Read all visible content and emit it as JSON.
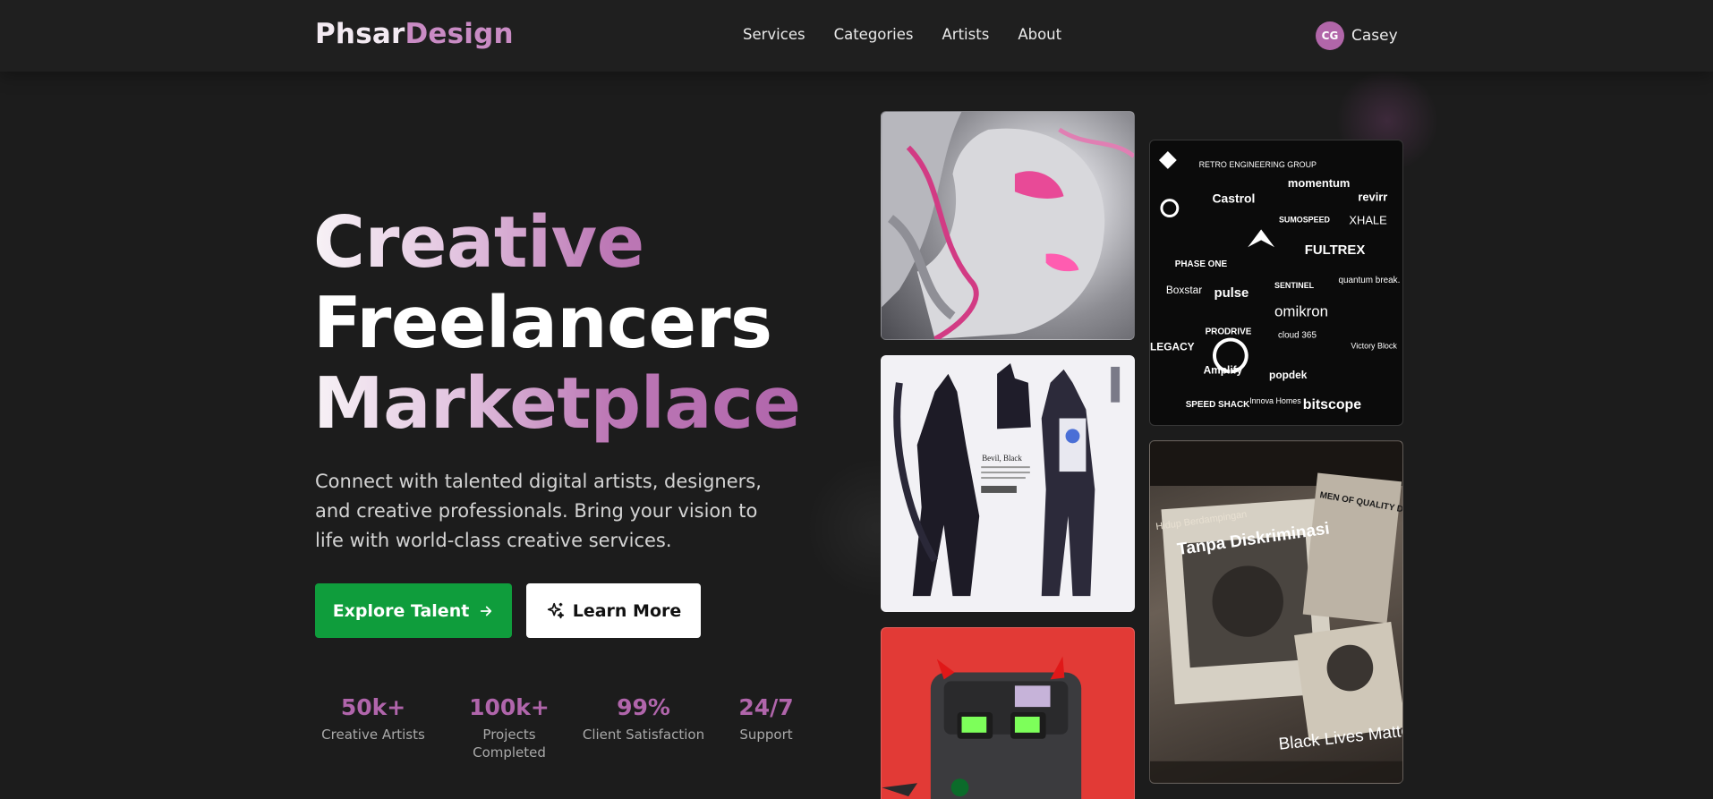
{
  "nav": {
    "logo_part1": "Phsar",
    "logo_part2": "Design",
    "links": [
      "Services",
      "Categories",
      "Artists",
      "About"
    ],
    "user": {
      "initials": "CG",
      "name": "Casey"
    }
  },
  "hero": {
    "headline": [
      "Creative",
      "Freelancers",
      "Marketplace"
    ],
    "subtitle": "Connect with talented digital artists, designers, and creative professionals. Bring your vision to life with world-class creative services.",
    "primary_button": "Explore Talent",
    "secondary_button": "Learn More"
  },
  "stats": [
    {
      "value": "50k+",
      "label": "Creative Artists"
    },
    {
      "value": "100k+",
      "label": "Projects Completed"
    },
    {
      "value": "99%",
      "label": "Client Satisfaction"
    },
    {
      "value": "24/7",
      "label": "Support"
    }
  ],
  "gallery": {
    "logo_wall": [
      "RETRO ENGINEERING GROUP",
      "momentum",
      "revirr",
      "Castrol",
      "SUMOSPEED",
      "XHALE",
      "FULTREX",
      "PHASE ONE",
      "Boxstar",
      "pulse",
      "SENTINEL",
      "quantum break.",
      "omikron",
      "PRODRIVE",
      "cloud 365",
      "LEGACY",
      "Amplify",
      "popdek",
      "Victory Block",
      "SPEED SHACK",
      "Innova Homes",
      "bitscope"
    ],
    "character_sheet_label": "Bevil, Black",
    "poster_texts": [
      "Hidup Berdampingan",
      "Tanpa Diskriminasi",
      "MEN OF QUALITY DO NOT FEAR EQUALITY",
      "Black Lives Matter!!!"
    ]
  },
  "colors": {
    "background": "#1c1c1c",
    "accent": "#b065ab",
    "primary_button": "#0f9d3c"
  }
}
